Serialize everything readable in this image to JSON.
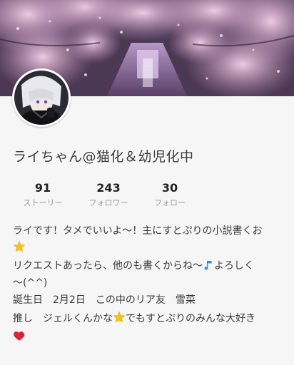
{
  "profile": {
    "name": "ライちゃん@猫化＆幼児化中",
    "stats": [
      {
        "value": "91",
        "label": "ストーリー"
      },
      {
        "value": "243",
        "label": "フォロワー"
      },
      {
        "value": "30",
        "label": "フォロー"
      }
    ],
    "bio": {
      "line1": "ライです！タメでいいよ〜！主にすとぷりの小説書くお",
      "line3": "リクエストあったら、他のも書くからね〜",
      "line3b": "よろしく",
      "line4": "〜(^^)",
      "line5": "誕生日　2月2日　この中のリア友　雪菜",
      "line6a": "推し　ジェルくんかな",
      "line6b": "でもすとぷりのみんな大好き"
    },
    "icons": {
      "bio_star_1": "star-icon",
      "bio_note": "music-note-icon",
      "bio_star_2": "star-icon",
      "bio_heart": "heart-icon"
    },
    "colors": {
      "star": "#f5c518",
      "heart": "#e0203a",
      "note": "#3a8fd8"
    }
  }
}
